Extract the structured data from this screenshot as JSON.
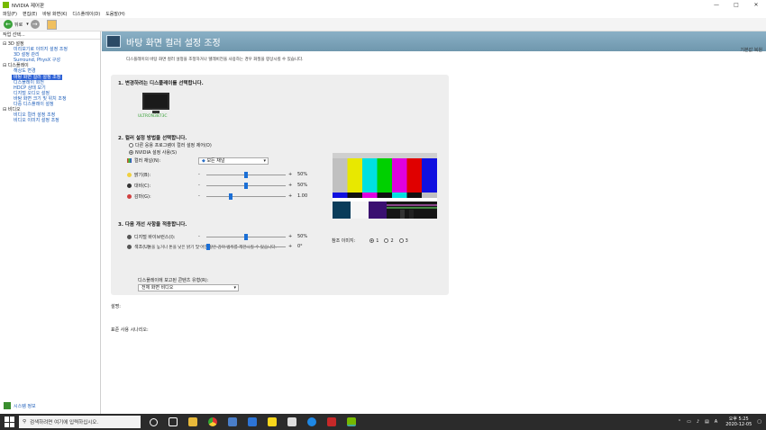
{
  "window": {
    "title": "NVIDIA 제어판",
    "min": "—",
    "max": "□",
    "close": "✕"
  },
  "menu": [
    "파일(F)",
    "편집(E)",
    "바탕 화면(K)",
    "디스플레이(D)",
    "도움말(H)"
  ],
  "toolbar": {
    "back_label": "뒤로"
  },
  "sidebar": {
    "header": "작업 선택...",
    "tree": [
      {
        "type": "cat",
        "label": "⊟ 3D 설정"
      },
      {
        "type": "item",
        "label": "미리보기로 이미지 설정 조정"
      },
      {
        "type": "item",
        "label": "3D 설정 관리"
      },
      {
        "type": "item",
        "label": "Surround, PhysX 구성"
      },
      {
        "type": "cat",
        "label": "⊟ 디스플레이"
      },
      {
        "type": "item",
        "label": "해상도 변경"
      },
      {
        "type": "item",
        "label": "바탕 화면 컬러 설정 조정",
        "selected": true
      },
      {
        "type": "item",
        "label": "디스플레이 회전"
      },
      {
        "type": "item",
        "label": "HDCP 상태 보기"
      },
      {
        "type": "item",
        "label": "디지털 오디오 설정"
      },
      {
        "type": "item",
        "label": "바탕 화면 크기 및 위치 조정"
      },
      {
        "type": "item",
        "label": "다중 디스플레이 설정"
      },
      {
        "type": "cat",
        "label": "⊟ 비디오"
      },
      {
        "type": "item",
        "label": "비디오 컬러 설정 조정"
      },
      {
        "type": "item",
        "label": "비디오 이미지 설정 조정"
      }
    ],
    "footer": "시스템 정보"
  },
  "page": {
    "title": "바탕 화면 컬러 설정 조정",
    "restore": "기본값 복원",
    "description": "디스플레이의 바탕 화면 컬러 설정을 조정하거나 텔레비전을 사용하는 경우 화질을 향상시킬 수 있습니다.",
    "sec1": "1. 변경하려는 디스플레이를 선택합니다.",
    "monitor_name": "ULTRON3873C",
    "sec2": "2. 컬러 설정 방법을 선택합니다.",
    "radio_other": "다른 응용 프로그램이 컬러 설정 제어(O)",
    "radio_nvidia": "NVIDIA 설정 사용(S)",
    "channel_label": "컬러 채널(N):",
    "channel_value": "모든 채널",
    "sliders": [
      {
        "label": "밝기(B):",
        "value": "50%",
        "level": 0.5,
        "color": "#f0d040"
      },
      {
        "label": "대비(C):",
        "value": "50%",
        "level": 0.5,
        "color": "#333333"
      },
      {
        "label": "감마(G):",
        "value": "1.00",
        "level": 0.3,
        "color": "#d04040"
      }
    ],
    "note": "톤을 높거나 톤을 낮은 밝기 및 어떤 같은 감마 범위를 제한시킬 수 있습니다.",
    "sec3": "3. 다음 개선 사항을 적용합니다.",
    "sliders2": [
      {
        "label": "디지털 바이브런스(I):",
        "value": "50%",
        "level": 0.5
      },
      {
        "label": "색조(U):",
        "value": "0°",
        "level": 0.0
      }
    ],
    "ref_label": "참조 이미지:",
    "ref_options": [
      "1",
      "2",
      "3"
    ],
    "content_type_label": "디스플레이에 보고된 콘텐츠 유형(R):",
    "content_type_value": "전체 화면 비디오",
    "desc_label": "설명:",
    "usage_label": "표준 사용 시나리오:",
    "minus": "-",
    "plus": "+"
  },
  "taskbar": {
    "search_placeholder": "검색하려면 여기에 입력하십시오.",
    "ime": "A",
    "time": "오후 5:25",
    "date": "2020-12-05"
  },
  "colors": {
    "accent": "#76b900",
    "selection": "#2f62d6",
    "banner": "#7aa1b8"
  }
}
